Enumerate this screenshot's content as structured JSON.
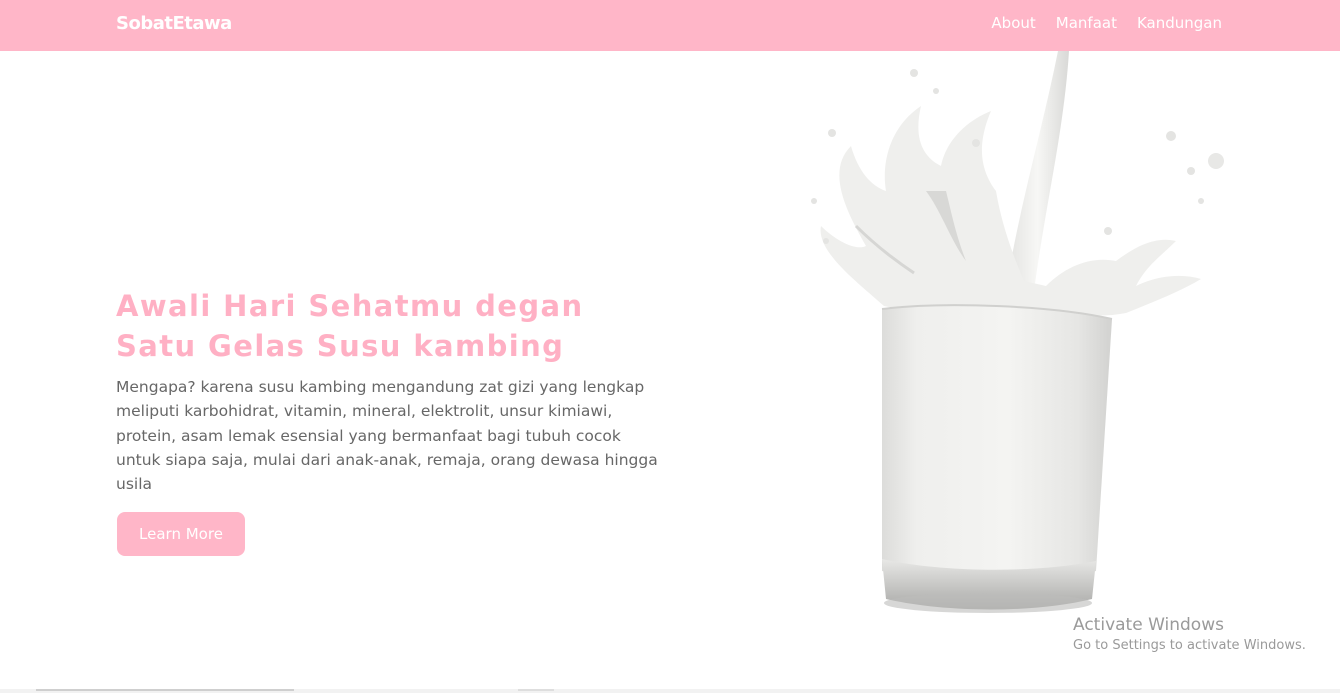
{
  "navbar": {
    "brand": "SobatEtawa",
    "links": [
      {
        "label": "About"
      },
      {
        "label": "Manfaat"
      },
      {
        "label": "Kandungan"
      }
    ]
  },
  "hero": {
    "title": "Awali Hari Sehatmu degan\nSatu Gelas Susu kambing",
    "description": "Mengapa? karena susu kambing mengandung zat gizi yang lengkap meliputi karbohidrat, vitamin, mineral, elektrolit, unsur kimiawi, protein, asam lemak esensial yang bermanfaat bagi tubuh cocok untuk siapa saja, mulai dari anak-anak, remaja, orang dewasa hingga usila",
    "button_label": "Learn More"
  },
  "watermark": {
    "title": "Activate Windows",
    "subtitle": "Go to Settings to activate Windows."
  },
  "colors": {
    "brand_pink": "#ffb6c8",
    "title_pink": "#ffb0c4",
    "body_text": "#676767"
  }
}
